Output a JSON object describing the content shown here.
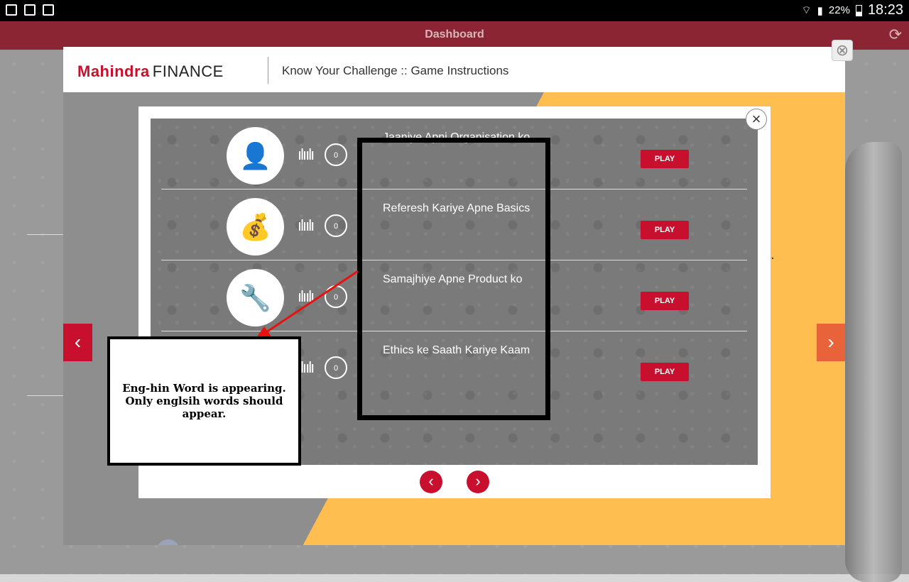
{
  "status_bar": {
    "battery": "22%",
    "time": "18:23"
  },
  "app_bar": {
    "title": "Dashboard"
  },
  "modal": {
    "brand_primary": "Mahindra",
    "brand_secondary": "FINANCE",
    "title": "Know Your Challenge :: Game Instructions"
  },
  "game_list": {
    "rows": [
      {
        "label": "Jaaniye Apni Organisation ko",
        "count": "0",
        "play": "PLAY",
        "icon": "presenter-icon"
      },
      {
        "label": "Referesh Kariye Apne Basics",
        "count": "0",
        "play": "PLAY",
        "icon": "money-bag-icon"
      },
      {
        "label": "Samajhiye Apne Product ko",
        "count": "0",
        "play": "PLAY",
        "icon": "tools-icon"
      },
      {
        "label": "Ethics ke Saath Kariye Kaam",
        "count": "0",
        "play": "PLAY",
        "icon": "handshake-icon"
      }
    ]
  },
  "annotation": {
    "note": "Eng-hin Word is appearing. Only englsih words should appear."
  },
  "colors": {
    "brand_red": "#c8102e",
    "header_maroon": "#8c2533",
    "accent_yellow": "#ffbe4f",
    "accent_orange": "#e8623a"
  }
}
